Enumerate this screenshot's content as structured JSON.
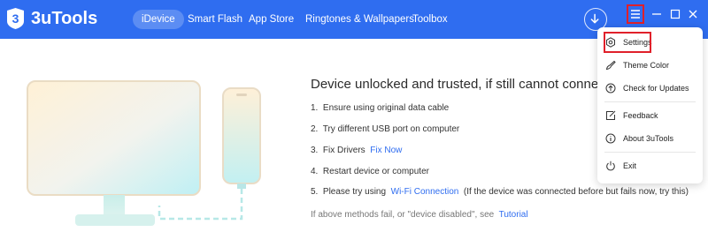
{
  "app": {
    "name": "3uTools",
    "logo_glyph": "3",
    "accent": "#2f6df0"
  },
  "nav": [
    {
      "label": "iDevice",
      "active": true
    },
    {
      "label": "Smart Flash",
      "active": false
    },
    {
      "label": "App Store",
      "active": false
    },
    {
      "label": "Ringtones & Wallpapers",
      "active": false
    },
    {
      "label": "Toolbox",
      "active": false
    }
  ],
  "window_controls": {
    "menu": "menu-icon",
    "minimize": "minimize-icon",
    "maximize": "maximize-icon",
    "close": "close-icon",
    "download": "download-icon"
  },
  "main": {
    "title": "Device unlocked and trusted, if still cannot connect try",
    "steps": [
      {
        "num": "1.",
        "text": "Ensure using original data cable"
      },
      {
        "num": "2.",
        "text": "Try different USB port on computer"
      },
      {
        "num": "3.",
        "text": "Fix Drivers",
        "link": "Fix Now"
      },
      {
        "num": "4.",
        "text": "Restart device or computer"
      },
      {
        "num": "5.",
        "text": "Please try using",
        "link": "Wi-Fi Connection",
        "suffix": "(If the device was connected before but fails now, try this)"
      }
    ],
    "footnote": {
      "text": "If above methods fail, or \"device disabled\", see",
      "link": "Tutorial"
    }
  },
  "dropdown": {
    "items": [
      {
        "label": "Settings",
        "icon": "settings-icon",
        "highlighted": true
      },
      {
        "label": "Theme Color",
        "icon": "theme-color-icon"
      },
      {
        "label": "Check for Updates",
        "icon": "update-icon"
      },
      {
        "label": "Feedback",
        "icon": "feedback-icon"
      },
      {
        "label": "About 3uTools",
        "icon": "info-icon"
      },
      {
        "label": "Exit",
        "icon": "power-icon"
      }
    ]
  }
}
